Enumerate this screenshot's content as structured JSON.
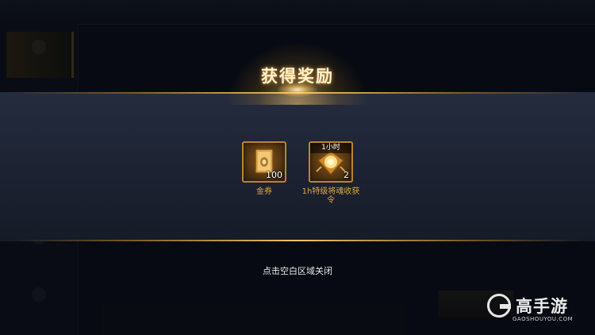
{
  "dialog": {
    "title": "获得奖励",
    "close_hint": "点击空白区域关闭"
  },
  "rewards": [
    {
      "name": "金券",
      "quantity": "100",
      "icon": "gold-voucher-card-icon"
    },
    {
      "name": "1h特级将魂收获令",
      "quantity": "2",
      "duration": "1小时",
      "icon": "golden-talisman-token-icon"
    }
  ],
  "watermark": {
    "brand": "高手游",
    "domain": "GAOSHOUYOU.COM"
  },
  "colors": {
    "accent_gold": "#f2c464",
    "reward_label": "#e3a83e",
    "panel": "#1c2232"
  }
}
